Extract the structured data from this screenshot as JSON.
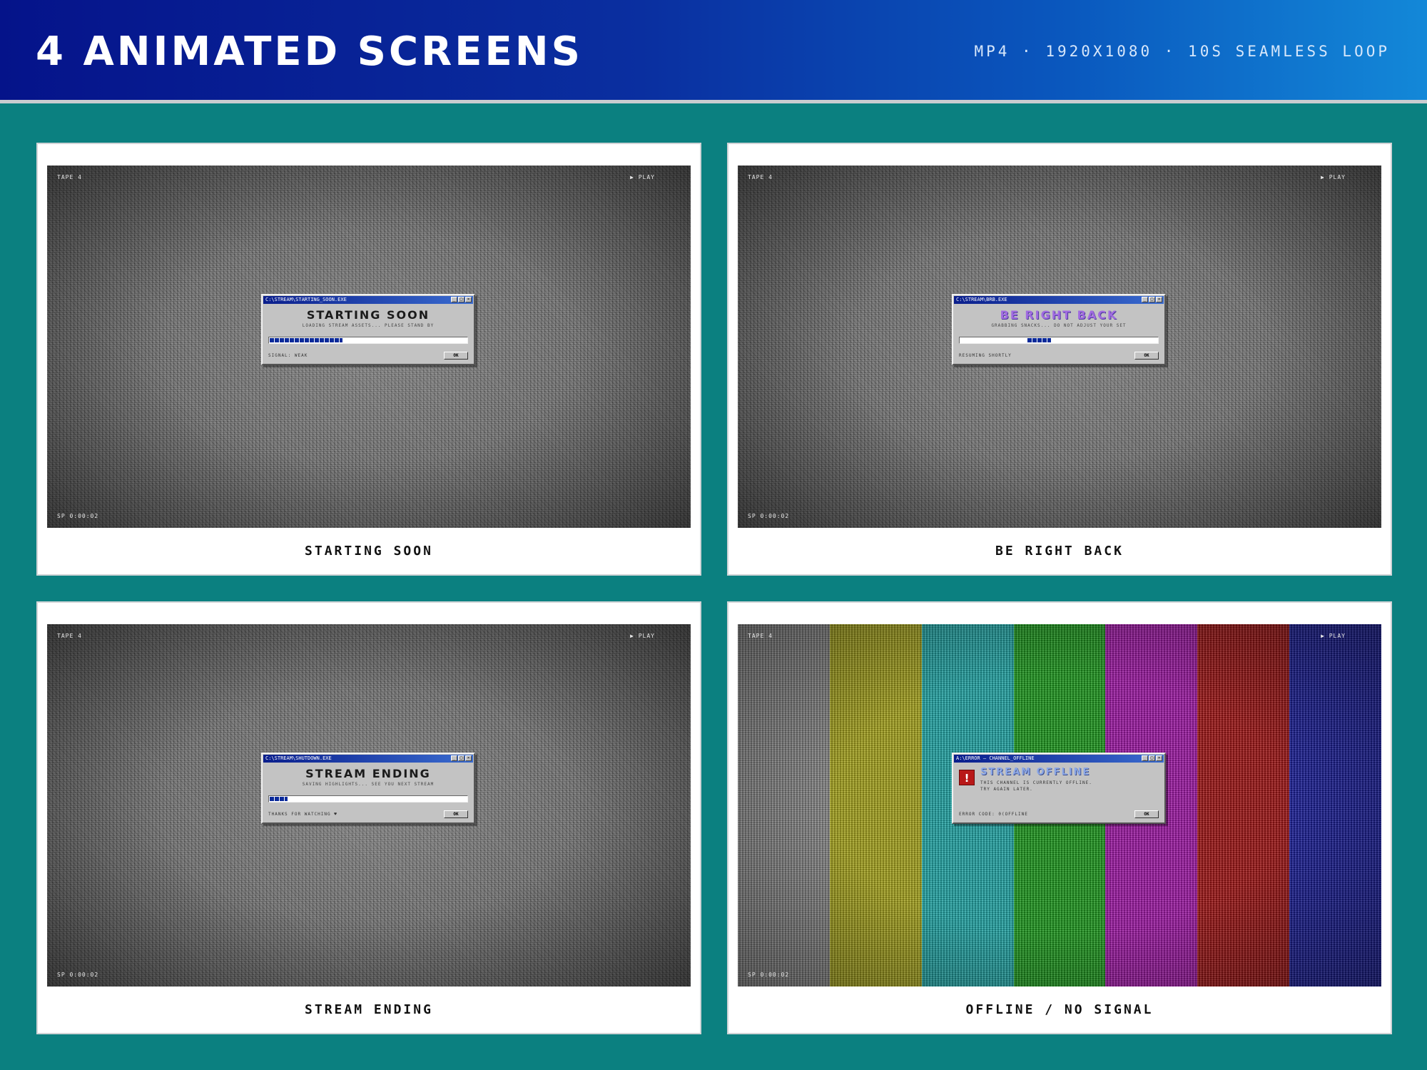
{
  "header": {
    "title": "4 ANIMATED SCREENS",
    "spec": "MP4 · 1920X1080 · 10S SEAMLESS LOOP"
  },
  "osd": {
    "tape": "TAPE 4",
    "play": "▶ PLAY",
    "timecode": "SP 0:00:02"
  },
  "cards": [
    {
      "caption": "STARTING SOON",
      "dialog": {
        "title_bar": "C:\\STREAM\\STARTING_SOON.EXE",
        "heading": "STARTING SOON",
        "subtext": "LOADING STREAM ASSETS... PLEASE STAND BY",
        "progress": 0.37,
        "status": "SIGNAL: WEAK",
        "ok": "OK"
      }
    },
    {
      "caption": "BE RIGHT BACK",
      "dialog": {
        "title_bar": "C:\\STREAM\\BRB.EXE",
        "heading": "BE RIGHT BACK",
        "subtext": "GRABBING SNACKS... DO NOT ADJUST YOUR SET",
        "progress": 0.12,
        "status": "RESUMING SHORTLY",
        "ok": "OK"
      }
    },
    {
      "caption": "STREAM ENDING",
      "dialog": {
        "title_bar": "C:\\STREAM\\SHUTDOWN.EXE",
        "heading": "STREAM ENDING",
        "subtext": "SAVING HIGHLIGHTS... SEE YOU NEXT STREAM",
        "progress": 0.09,
        "status": "THANKS FOR WATCHING ♥",
        "ok": "OK"
      }
    },
    {
      "caption": "OFFLINE / NO SIGNAL",
      "dialog": {
        "title_bar": "A:\\ERROR — CHANNEL_OFFLINE",
        "heading": "STREAM OFFLINE",
        "line1": "THIS CHANNEL IS CURRENTLY OFFLINE.",
        "line2": "TRY AGAIN LATER.",
        "status": "ERROR CODE: 0(OFFLINE",
        "ok": "OK"
      },
      "bar_colors": [
        "#8a8a8a",
        "#a9a61e",
        "#22a8a8",
        "#1f9a1f",
        "#a018a6",
        "#a11515",
        "#1b1f9c"
      ]
    }
  ],
  "colors": {
    "background": "#0b8080",
    "header_start": "#05138a",
    "header_end": "#1388d8",
    "titlebar": "#0a1e8c",
    "progress_fill": "#0a2a9a"
  }
}
